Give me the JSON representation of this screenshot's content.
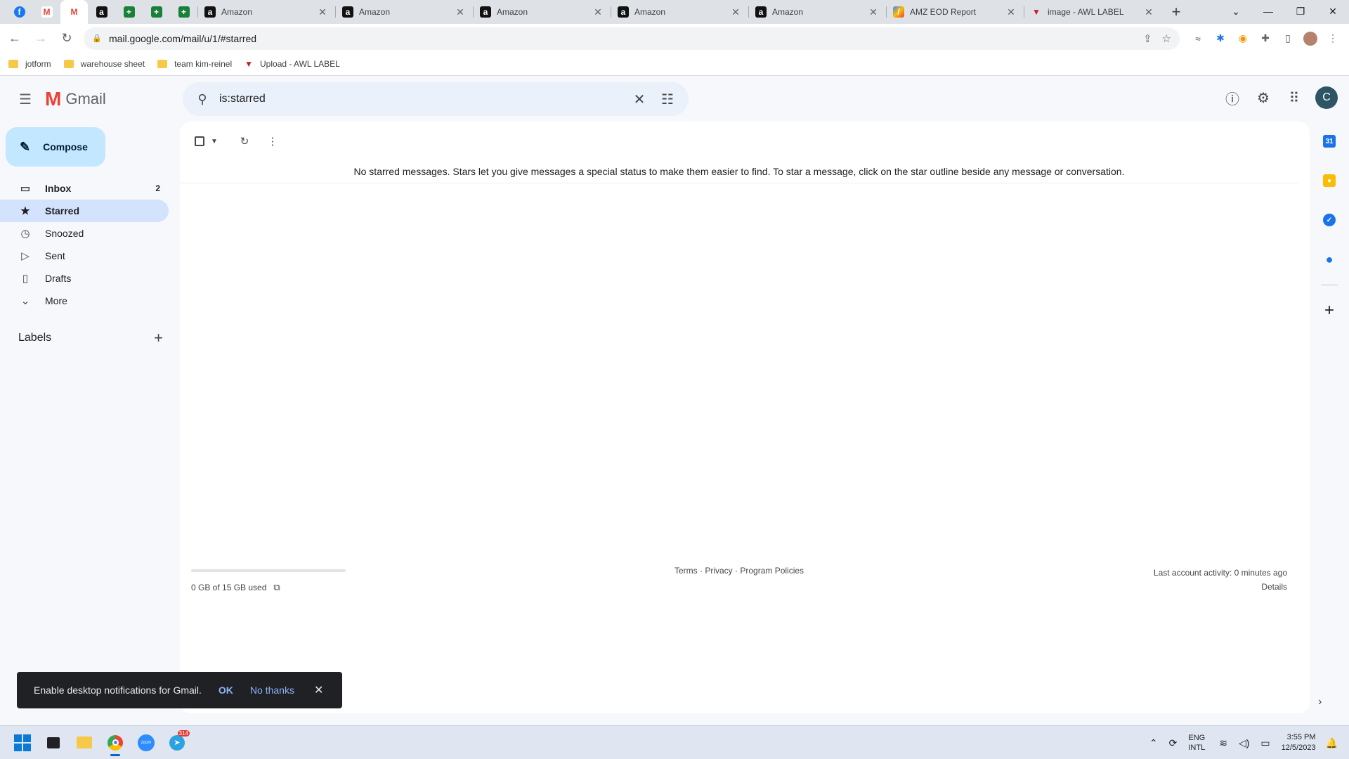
{
  "browser": {
    "pinned_tabs": [
      {
        "icon": "facebook-icon",
        "glyph": "f",
        "color": "#1877f2",
        "active": false
      },
      {
        "icon": "gmail-icon",
        "glyph": "M",
        "color": "#ea4335",
        "active": false
      },
      {
        "icon": "gmail-icon",
        "glyph": "M",
        "color": "#ea4335",
        "active": true
      },
      {
        "icon": "amazon-icon",
        "glyph": "a",
        "color": "#111111",
        "active": false
      },
      {
        "icon": "sheets-icon",
        "glyph": "+",
        "color": "#188038",
        "active": false
      },
      {
        "icon": "sheets-icon",
        "glyph": "+",
        "color": "#188038",
        "active": false
      },
      {
        "icon": "sheets-icon",
        "glyph": "+",
        "color": "#188038",
        "active": false
      }
    ],
    "tabs": [
      {
        "title": "Amazon",
        "icon": "amazon-icon"
      },
      {
        "title": "Amazon",
        "icon": "amazon-icon"
      },
      {
        "title": "Amazon",
        "icon": "amazon-icon"
      },
      {
        "title": "Amazon",
        "icon": "amazon-icon"
      },
      {
        "title": "Amazon",
        "icon": "amazon-icon"
      },
      {
        "title": "AMZ EOD Report",
        "icon": "report-icon"
      },
      {
        "title": "image - AWL LABEL",
        "icon": "awl-icon"
      }
    ],
    "url": "mail.google.com/mail/u/1/#starred",
    "bookmarks": [
      {
        "label": "jotform",
        "icon": "folder-icon"
      },
      {
        "label": "warehouse sheet",
        "icon": "folder-icon"
      },
      {
        "label": "team kim-reinel",
        "icon": "folder-icon"
      },
      {
        "label": "Upload - AWL LABEL",
        "icon": "awl-icon"
      }
    ]
  },
  "gmail": {
    "logo_text": "Gmail",
    "search_query": "is:starred",
    "avatar_letter": "C",
    "compose_label": "Compose",
    "nav": {
      "inbox": {
        "label": "Inbox",
        "count": "2"
      },
      "starred": {
        "label": "Starred"
      },
      "snoozed": {
        "label": "Snoozed"
      },
      "sent": {
        "label": "Sent"
      },
      "drafts": {
        "label": "Drafts"
      },
      "more": {
        "label": "More"
      }
    },
    "labels_heading": "Labels",
    "empty_message": "No starred messages. Stars let you give messages a special status to make them easier to find. To star a message, click on the star outline beside any message or conversation.",
    "storage": {
      "text": "0 GB of 15 GB used",
      "used_fraction": 0.0
    },
    "footer": {
      "terms": "Terms",
      "privacy": "Privacy",
      "program_policies": "Program Policies",
      "separator": " · "
    },
    "activity": {
      "text": "Last account activity: 0 minutes ago",
      "details": "Details"
    },
    "side_panel": [
      {
        "icon": "calendar-icon",
        "color": "#1a73e8"
      },
      {
        "icon": "keep-icon",
        "color": "#fbbc04"
      },
      {
        "icon": "tasks-icon",
        "color": "#1a73e8"
      },
      {
        "icon": "contacts-icon",
        "color": "#1a73e8"
      }
    ]
  },
  "snackbar": {
    "message": "Enable desktop notifications for Gmail.",
    "ok": "OK",
    "no_thanks": "No thanks"
  },
  "taskbar": {
    "lang_top": "ENG",
    "lang_bottom": "INTL",
    "time": "3:55 PM",
    "date": "12/5/2023",
    "telegram_badge": "314"
  },
  "colors": {
    "accent": "#0b57d0",
    "compose_bg": "#c2e7ff",
    "active_nav_bg": "#d3e3fd"
  }
}
